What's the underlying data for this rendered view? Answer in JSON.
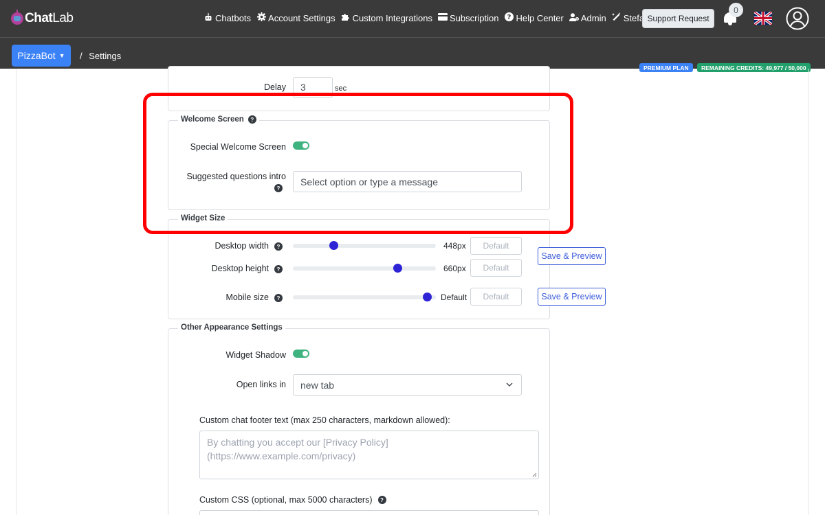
{
  "app": {
    "logo_chat": "Chat",
    "logo_lab": "Lab"
  },
  "nav": {
    "items": [
      {
        "label": "Chatbots",
        "icon": "robot-icon"
      },
      {
        "label": "Account Settings",
        "icon": "gear-icon"
      },
      {
        "label": "Custom Integrations",
        "icon": "puzzle-icon"
      },
      {
        "label": "Subscription",
        "icon": "credit-card-icon"
      },
      {
        "label": "Help Center",
        "icon": "question-circle-icon"
      },
      {
        "label": "Admin",
        "icon": "user-cog-icon"
      },
      {
        "label": "Stefan AI",
        "icon": "magic-wand-icon"
      }
    ],
    "support_label": "Support Request",
    "notification_count": "0"
  },
  "breadcrumb": {
    "bot_name": "PizzaBot",
    "separator": "/",
    "page": "Settings"
  },
  "plan": {
    "premium": "PREMIUM PLAN",
    "credits": "REMAINING CREDITS: 49,977 / 50,000"
  },
  "delay": {
    "label": "Delay",
    "value": "3",
    "unit": "sec"
  },
  "welcome": {
    "title": "Welcome Screen",
    "special_label": "Special Welcome Screen",
    "special_on": true,
    "questions_label": "Suggested questions intro",
    "questions_placeholder": "Select option or type a message"
  },
  "widget_size": {
    "title": "Widget Size",
    "desktop_width_label": "Desktop width",
    "desktop_width_value": "448px",
    "desktop_width_fraction": 0.27,
    "desktop_height_label": "Desktop height",
    "desktop_height_value": "660px",
    "desktop_height_fraction": 0.75,
    "mobile_label": "Mobile size",
    "mobile_value": "Default",
    "mobile_fraction": 0.97,
    "default_placeholder": "Default",
    "save_label": "Save & Preview"
  },
  "other": {
    "title": "Other Appearance Settings",
    "shadow_label": "Widget Shadow",
    "shadow_on": true,
    "open_links_label": "Open links in",
    "open_links_value": "new tab",
    "footer_label": "Custom chat footer text (max 250 characters, markdown allowed):",
    "footer_placeholder_1": "By chatting you accept our [Privacy Policy]",
    "footer_placeholder_2": "(https://www.example.com/privacy)",
    "css_label": "Custom CSS (optional, max 5000 characters)"
  },
  "colors": {
    "topbar": "#3a3a3a",
    "accent": "#3b82f6",
    "toggle_on": "#3fb37f",
    "slider_thumb": "#2f23d6",
    "highlight": "#ff0000"
  }
}
